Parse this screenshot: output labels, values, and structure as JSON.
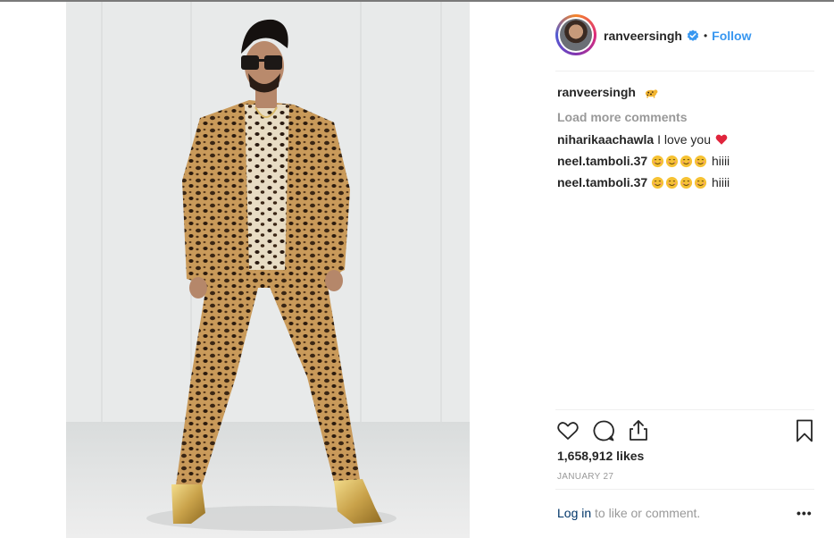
{
  "post": {
    "username": "ranveersingh",
    "follow_label": "Follow",
    "separator": "•"
  },
  "caption": {
    "username": "ranveersingh",
    "emoji": "leopard"
  },
  "comments": {
    "load_more_label": "Load more comments",
    "items": [
      {
        "username": "niharikaachawla",
        "text": "I love you",
        "emoji": "heart"
      },
      {
        "username": "neel.tamboli.37",
        "text": "hiiii",
        "emoji": "smiling-face x4"
      },
      {
        "username": "neel.tamboli.37",
        "text": "hiiii",
        "emoji": "smiling-face x4"
      }
    ]
  },
  "stats": {
    "likes": "1,658,912 likes",
    "date": "JANUARY 27"
  },
  "login": {
    "link_label": "Log in",
    "rest_text": "to like or comment.",
    "more_label": "•••"
  },
  "colors": {
    "accent": "#3897f0",
    "link": "#003569",
    "muted": "#999999",
    "heart": "#ed4956"
  }
}
